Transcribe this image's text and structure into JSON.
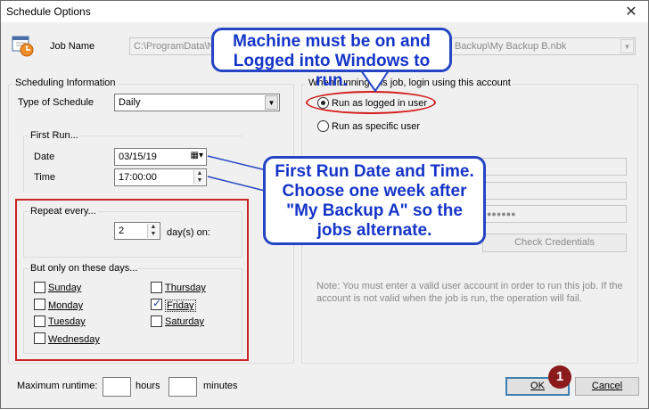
{
  "window": {
    "title": "Schedule Options",
    "close": "✕"
  },
  "job": {
    "label": "Job Name",
    "value": "C:\\ProgramData\\N",
    "value_tail": "Backup\\My Backup B.nbk"
  },
  "scheduling": {
    "group_label": "Scheduling Information",
    "type_label": "Type of Schedule",
    "type_value": "Daily",
    "first_run": {
      "group_label": "First Run...",
      "date_label": "Date",
      "date_value": "03/15/19",
      "time_label": "Time",
      "time_value": "17:00:00"
    },
    "repeat": {
      "group_label": "Repeat every...",
      "value": "2",
      "unit": "day(s) on:"
    },
    "days": {
      "group_label": "But only on these days...",
      "items": [
        {
          "label": "Sunday",
          "checked": false
        },
        {
          "label": "Monday",
          "checked": false
        },
        {
          "label": "Tuesday",
          "checked": false
        },
        {
          "label": "Wednesday",
          "checked": false
        },
        {
          "label": "Thursday",
          "checked": false
        },
        {
          "label": "Friday",
          "checked": true
        },
        {
          "label": "Saturday",
          "checked": false
        }
      ]
    }
  },
  "login": {
    "group_label": "When running this job, login using this account",
    "option1": "Run as logged in user",
    "option2": "Run as specific user",
    "password_mask": "●●●●●●",
    "check_credentials": "Check Credentials",
    "note": "Note: You must enter a valid user account in order to run this job. If the account is not valid when the job is run, the operation will fail."
  },
  "runtime": {
    "label": "Maximum runtime:",
    "hours_label": "hours",
    "minutes_label": "minutes"
  },
  "buttons": {
    "ok": "OK",
    "cancel": "Cancel"
  },
  "annotations": {
    "callout_top": "Machine must be on and Logged into Windows to run.",
    "callout_mid": "First Run Date and Time. Choose one week after \"My Backup A\" so the jobs alternate.",
    "badge": "1"
  },
  "colors": {
    "callout_text": "#1535c8",
    "callout_border": "#2545c4",
    "highlight_red": "#cc2222",
    "badge_bg": "#8b1a1a"
  }
}
